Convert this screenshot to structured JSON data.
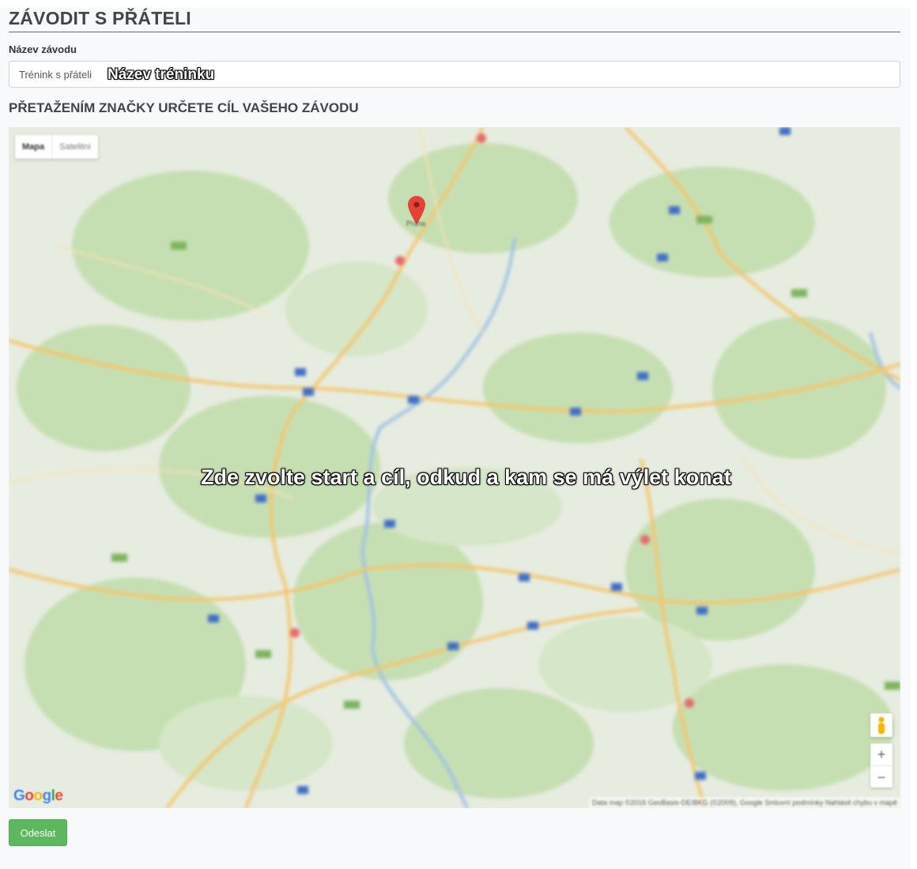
{
  "page": {
    "title": "ZÁVODIT S PŘÁTELI",
    "race_name_label": "Název závodu",
    "race_name_value": "Trénink s přáteli",
    "race_name_annotation": "Název tréninku",
    "map_heading": "PŘETAŽENÍM ZNAČKY URČETE CÍL VAŠEHO ZÁVODU"
  },
  "map": {
    "type_buttons": [
      "Mapa",
      "Satelitní"
    ],
    "active_type": "Mapa",
    "overlay_instruction": "Zde zvolte start a cíl, odkud a kam se má výlet konat",
    "marker_label": "Praha",
    "logo_text": "Google",
    "attribution": "Data map ©2016 GeoBasis-DE/BKG (©2009), Google   Smluvní podmínky   Nahlásit chybu v mapě",
    "zoom_in": "+",
    "zoom_out": "−",
    "icons": [
      "map-marker-icon",
      "pegman-icon",
      "zoom-in-icon",
      "zoom-out-icon"
    ]
  },
  "actions": {
    "submit_label": "Odeslat"
  },
  "colors": {
    "submit": "#5cb85c",
    "map_land": "#e6ecdf",
    "forest": "#c6dfb2",
    "river": "#9ec2e6",
    "road": "#f6c56d",
    "marker": "#e64236"
  }
}
